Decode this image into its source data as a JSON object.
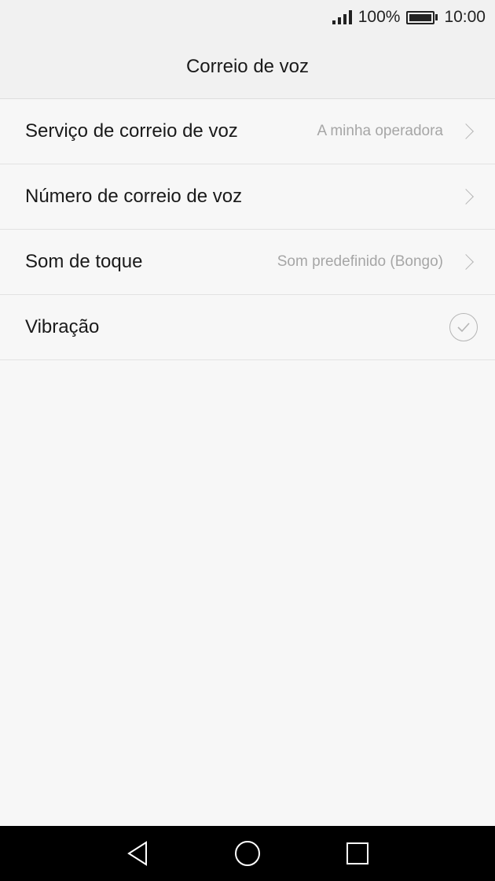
{
  "status_bar": {
    "battery": "100%",
    "time": "10:00"
  },
  "header": {
    "title": "Correio de voz"
  },
  "settings": {
    "items": [
      {
        "label": "Serviço de correio de voz",
        "value": "A minha operadora",
        "accessory": "chevron-right-icon"
      },
      {
        "label": "Número de correio de voz",
        "value": "",
        "accessory": "chevron-right-icon"
      },
      {
        "label": "Som de toque",
        "value": "Som predefinido (Bongo)",
        "accessory": "chevron-right-icon"
      },
      {
        "label": "Vibração",
        "value": "",
        "accessory": "checkmark-circle-icon",
        "checked": true
      }
    ]
  },
  "nav_bar": {
    "buttons": [
      "back-icon",
      "home-icon",
      "recents-icon"
    ]
  },
  "colors": {
    "background": "#f7f7f7",
    "header_background": "#f1f1f1",
    "secondary_text": "#a6a6a6",
    "nav_bar": "#000000"
  }
}
